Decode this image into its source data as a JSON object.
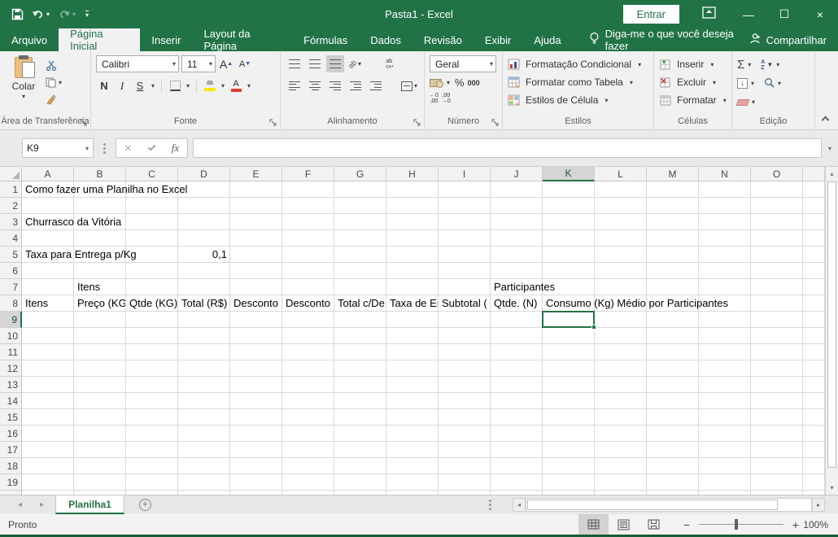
{
  "colors": {
    "accent": "#217346",
    "titlebar_green": "#217346",
    "selection_green": "#217346",
    "fill_yellow": "#ffe600",
    "font_color_red": "#e03c31"
  },
  "titlebar": {
    "title": "Pasta1 - Excel",
    "sign_in_label": "Entrar"
  },
  "tabs": {
    "items": [
      "Arquivo",
      "Página Inicial",
      "Inserir",
      "Layout da Página",
      "Fórmulas",
      "Dados",
      "Revisão",
      "Exibir",
      "Ajuda"
    ],
    "active": "Página Inicial",
    "tell_me": "Diga-me o que você deseja fazer",
    "share_label": "Compartilhar"
  },
  "ribbon": {
    "clipboard": {
      "label": "Área de Transferência",
      "paste_label": "Colar"
    },
    "font": {
      "label": "Fonte",
      "family": "Calibri",
      "size": "11",
      "bold": "N",
      "italic": "I",
      "underline": "S"
    },
    "alignment": {
      "label": "Alinhamento"
    },
    "number": {
      "label": "Número",
      "format": "Geral",
      "percent": "%",
      "thousands": "000"
    },
    "styles": {
      "label": "Estilos",
      "conditional": "Formatação Condicional",
      "format_table": "Formatar como Tabela",
      "cell_styles": "Estilos de Célula"
    },
    "cells": {
      "label": "Células",
      "insert": "Inserir",
      "delete": "Excluir",
      "format": "Formatar"
    },
    "editing": {
      "label": "Edição",
      "autosum": "Σ"
    }
  },
  "formula_bar": {
    "name_box": "K9",
    "fx_label": "fx",
    "value": ""
  },
  "grid": {
    "columns": [
      "A",
      "B",
      "C",
      "D",
      "E",
      "F",
      "G",
      "H",
      "I",
      "J",
      "K",
      "L",
      "M",
      "N",
      "O"
    ],
    "visible_rows": 19,
    "selected_cell": "K9",
    "selected_column": "K",
    "selected_row": 9,
    "cells": {
      "A1": "Como fazer uma Planilha no Excel",
      "A3": "Churrasco da Vitória",
      "A5": "Taxa para Entrega p/Kg",
      "D5": "0,1",
      "B7": "Itens",
      "J7": "Participantes",
      "A8": "Itens",
      "B8": "Preço (KG",
      "C8": "Qtde (KG)",
      "D8": "Total (R$)",
      "E8": "Desconto",
      "F8": "Desconto",
      "G8": "Total c/De",
      "H8": "Taxa de Er",
      "I8": "Subtotal (",
      "J8": "Qtde. (N)",
      "K8": "Consumo (Kg) Médio por Participantes"
    },
    "cell_align": {
      "D5": "right"
    }
  },
  "sheet_bar": {
    "active_tab": "Planilha1"
  },
  "status_bar": {
    "status": "Pronto",
    "zoom": "100%"
  }
}
